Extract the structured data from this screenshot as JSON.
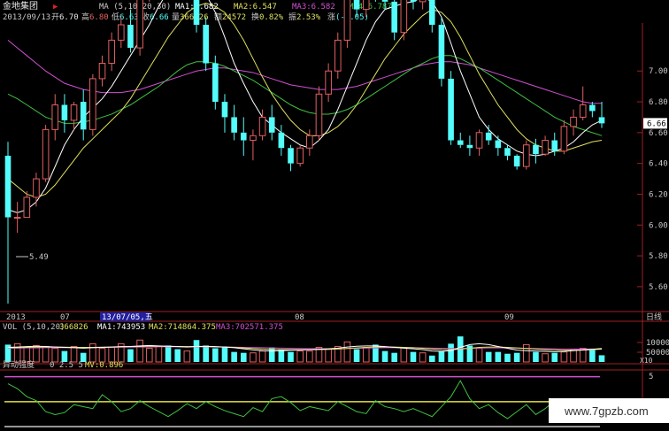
{
  "info": {
    "stock_name": "金地集团",
    "date_line": "2013/09/13",
    "open_label": "开",
    "open_value": "6.70",
    "high_label": "高",
    "high_value": "6.80",
    "low_label": "低",
    "low_value": "6.63",
    "close_label": "收",
    "close_value": "6.66",
    "vol_label": "量",
    "vol_value": "366826",
    "amount_label": "额",
    "amount_value": "24572",
    "turnover_label": "换",
    "turnover_value": "0.82%",
    "amplitude_label": "振",
    "amplitude_value": "2.53%",
    "change_label": "涨",
    "change_value": "(-0.05)",
    "ma_title": "MA (5,10,20,30)",
    "ma1": "MA1:6.682",
    "ma2": "MA2:6.547",
    "ma3": "MA3:6.582",
    "ma4": "MA4:6.787"
  },
  "toolbar": {
    "date_labels": [
      "2013",
      "07",
      "08",
      "09"
    ],
    "cursor_date": "13/07/05,五",
    "period_button": "日线"
  },
  "volume_panel": {
    "title": "VOL (5,10,20)",
    "value": "366826",
    "ma1": "MA1:743953",
    "ma2": "MA2:714864.375",
    "ma3": "MA3:702571.375",
    "y_ticks": [
      "100000",
      "50000"
    ],
    "unit": "X10"
  },
  "indicator_panel": {
    "title": "异动强度",
    "params": "0 2.5 5",
    "mv": "MV:0.896",
    "y_tick": "5"
  },
  "watermark": "www.7gpzb.com",
  "colors": {
    "up": "#e06060",
    "down": "#54fcfc",
    "ma1": "#ffffff",
    "ma2": "#e0e060",
    "ma3": "#d050d0",
    "ma4": "#40c040",
    "axis": "#a02020",
    "indicator_line": "#40c040",
    "level_high": "#d050d0",
    "level_mid": "#e0e040"
  },
  "chart_data": {
    "type": "candlestick",
    "y_ticks": [
      5.6,
      5.8,
      6.0,
      6.2,
      6.4,
      6.6,
      6.8,
      7.0
    ],
    "ylim": [
      5.45,
      7.3
    ],
    "min_label": "5.49",
    "last_price": "6.66",
    "candles": [
      [
        6.45,
        6.54,
        5.49,
        6.05
      ],
      [
        6.05,
        6.15,
        5.95,
        6.05
      ],
      [
        6.05,
        6.22,
        6.05,
        6.18
      ],
      [
        6.18,
        6.34,
        6.12,
        6.3
      ],
      [
        6.3,
        6.65,
        6.28,
        6.62
      ],
      [
        6.62,
        6.85,
        6.55,
        6.78
      ],
      [
        6.78,
        6.85,
        6.6,
        6.68
      ],
      [
        6.68,
        6.8,
        6.62,
        6.78
      ],
      [
        6.8,
        6.88,
        6.55,
        6.62
      ],
      [
        6.62,
        6.98,
        6.58,
        6.95
      ],
      [
        6.95,
        7.1,
        6.9,
        7.05
      ],
      [
        7.05,
        7.25,
        7.0,
        7.2
      ],
      [
        7.2,
        7.35,
        7.15,
        7.3
      ],
      [
        7.3,
        7.4,
        7.12,
        7.15
      ],
      [
        7.15,
        7.55,
        7.1,
        7.5
      ],
      [
        7.5,
        7.7,
        7.45,
        7.65
      ],
      [
        7.65,
        7.9,
        7.6,
        7.85
      ],
      [
        7.85,
        7.95,
        7.65,
        7.7
      ],
      [
        7.7,
        7.75,
        7.55,
        7.6
      ],
      [
        7.6,
        7.75,
        7.5,
        7.65
      ],
      [
        7.65,
        7.7,
        7.25,
        7.3
      ],
      [
        7.3,
        7.35,
        7.0,
        7.05
      ],
      [
        7.05,
        7.1,
        6.75,
        6.8
      ],
      [
        6.8,
        6.85,
        6.6,
        6.7
      ],
      [
        6.7,
        6.78,
        6.55,
        6.6
      ],
      [
        6.6,
        6.7,
        6.45,
        6.55
      ],
      [
        6.55,
        6.62,
        6.42,
        6.58
      ],
      [
        6.58,
        6.75,
        6.55,
        6.7
      ],
      [
        6.7,
        6.78,
        6.55,
        6.6
      ],
      [
        6.6,
        6.65,
        6.45,
        6.5
      ],
      [
        6.5,
        6.52,
        6.35,
        6.4
      ],
      [
        6.4,
        6.52,
        6.38,
        6.5
      ],
      [
        6.5,
        6.62,
        6.45,
        6.58
      ],
      [
        6.58,
        6.9,
        6.55,
        6.85
      ],
      [
        6.85,
        7.05,
        6.8,
        7.0
      ],
      [
        7.0,
        7.25,
        6.95,
        7.2
      ],
      [
        7.2,
        7.55,
        7.15,
        7.5
      ],
      [
        7.5,
        7.55,
        7.35,
        7.4
      ],
      [
        7.4,
        7.6,
        7.35,
        7.55
      ],
      [
        7.55,
        7.7,
        7.45,
        7.5
      ],
      [
        7.5,
        7.65,
        7.4,
        7.45
      ],
      [
        7.45,
        7.5,
        7.2,
        7.25
      ],
      [
        7.25,
        7.55,
        7.2,
        7.5
      ],
      [
        7.5,
        7.6,
        7.4,
        7.45
      ],
      [
        7.45,
        7.8,
        7.4,
        7.75
      ],
      [
        7.65,
        7.68,
        7.25,
        7.3
      ],
      [
        7.3,
        7.35,
        6.9,
        6.95
      ],
      [
        6.95,
        7.0,
        6.52,
        6.55
      ],
      [
        6.55,
        6.6,
        6.5,
        6.52
      ],
      [
        6.52,
        6.58,
        6.45,
        6.5
      ],
      [
        6.5,
        6.62,
        6.45,
        6.6
      ],
      [
        6.6,
        6.65,
        6.52,
        6.55
      ],
      [
        6.55,
        6.58,
        6.45,
        6.5
      ],
      [
        6.5,
        6.52,
        6.42,
        6.45
      ],
      [
        6.45,
        6.46,
        6.36,
        6.38
      ],
      [
        6.38,
        6.55,
        6.36,
        6.52
      ],
      [
        6.52,
        6.56,
        6.4,
        6.46
      ],
      [
        6.46,
        6.58,
        6.45,
        6.55
      ],
      [
        6.55,
        6.6,
        6.45,
        6.48
      ],
      [
        6.48,
        6.68,
        6.46,
        6.64
      ],
      [
        6.64,
        6.75,
        6.58,
        6.7
      ],
      [
        6.7,
        6.9,
        6.68,
        6.78
      ],
      [
        6.78,
        6.8,
        6.7,
        6.74
      ],
      [
        6.7,
        6.8,
        6.63,
        6.66
      ]
    ],
    "ma5": [
      6.1,
      6.08,
      6.1,
      6.15,
      6.24,
      6.38,
      6.52,
      6.62,
      6.7,
      6.76,
      6.82,
      6.9,
      7.0,
      7.1,
      7.2,
      7.3,
      7.42,
      7.52,
      7.58,
      7.62,
      7.6,
      7.5,
      7.38,
      7.22,
      7.05,
      6.92,
      6.8,
      6.7,
      6.65,
      6.6,
      6.56,
      6.52,
      6.5,
      6.55,
      6.62,
      6.75,
      6.9,
      7.05,
      7.2,
      7.32,
      7.4,
      7.42,
      7.44,
      7.45,
      7.48,
      7.45,
      7.35,
      7.18,
      7.0,
      6.85,
      6.7,
      6.62,
      6.56,
      6.52,
      6.48,
      6.46,
      6.45,
      6.46,
      6.48,
      6.5,
      6.54,
      6.6,
      6.65,
      6.68
    ],
    "ma10": [
      6.3,
      6.25,
      6.2,
      6.18,
      6.2,
      6.26,
      6.34,
      6.42,
      6.5,
      6.56,
      6.62,
      6.68,
      6.74,
      6.82,
      6.92,
      7.02,
      7.12,
      7.22,
      7.3,
      7.38,
      7.42,
      7.44,
      7.42,
      7.38,
      7.3,
      7.2,
      7.08,
      6.96,
      6.85,
      6.76,
      6.68,
      6.62,
      6.58,
      6.58,
      6.6,
      6.64,
      6.7,
      6.78,
      6.88,
      6.98,
      7.08,
      7.16,
      7.24,
      7.3,
      7.36,
      7.4,
      7.38,
      7.32,
      7.22,
      7.1,
      6.98,
      6.88,
      6.78,
      6.7,
      6.62,
      6.56,
      6.52,
      6.5,
      6.48,
      6.48,
      6.5,
      6.52,
      6.54,
      6.55
    ],
    "ma20": [
      6.85,
      6.82,
      6.78,
      6.74,
      6.7,
      6.68,
      6.66,
      6.66,
      6.67,
      6.68,
      6.7,
      6.72,
      6.75,
      6.78,
      6.82,
      6.86,
      6.9,
      6.95,
      7.0,
      7.04,
      7.06,
      7.06,
      7.05,
      7.03,
      7.0,
      6.97,
      6.94,
      6.9,
      6.86,
      6.82,
      6.78,
      6.75,
      6.73,
      6.72,
      6.72,
      6.73,
      6.75,
      6.78,
      6.82,
      6.86,
      6.9,
      6.94,
      6.98,
      7.02,
      7.05,
      7.08,
      7.1,
      7.1,
      7.08,
      7.05,
      7.02,
      6.98,
      6.94,
      6.9,
      6.86,
      6.82,
      6.78,
      6.74,
      6.7,
      6.67,
      6.64,
      6.62,
      6.6,
      6.58
    ],
    "ma30": [
      7.2,
      7.15,
      7.1,
      7.05,
      7.0,
      6.96,
      6.92,
      6.9,
      6.88,
      6.87,
      6.86,
      6.86,
      6.86,
      6.87,
      6.88,
      6.9,
      6.92,
      6.94,
      6.96,
      6.98,
      7.0,
      7.01,
      7.02,
      7.02,
      7.01,
      7.0,
      6.99,
      6.97,
      6.95,
      6.93,
      6.91,
      6.9,
      6.89,
      6.88,
      6.88,
      6.88,
      6.89,
      6.9,
      6.92,
      6.94,
      6.96,
      6.98,
      7.0,
      7.02,
      7.04,
      7.05,
      7.06,
      7.06,
      7.05,
      7.04,
      7.02,
      7.0,
      6.98,
      6.96,
      6.94,
      6.92,
      6.9,
      6.88,
      6.86,
      6.84,
      6.82,
      6.8,
      6.79,
      6.79
    ],
    "volume": {
      "ylim": [
        0,
        160000
      ],
      "values": [
        95000,
        100000,
        80000,
        90000,
        85000,
        75000,
        60000,
        85000,
        50000,
        100000,
        75000,
        80000,
        100000,
        70000,
        120000,
        75000,
        85000,
        90000,
        70000,
        60000,
        120000,
        90000,
        75000,
        85000,
        55000,
        50000,
        50000,
        60000,
        80000,
        70000,
        55000,
        60000,
        60000,
        80000,
        70000,
        85000,
        110000,
        70000,
        80000,
        95000,
        60000,
        50000,
        80000,
        55000,
        50000,
        35000,
        60000,
        100000,
        140000,
        90000,
        75000,
        55000,
        55000,
        45000,
        50000,
        95000,
        55000,
        45000,
        50000,
        55000,
        70000,
        75000,
        65000,
        36682
      ],
      "ma5": [
        80000,
        82000,
        84000,
        86000,
        85000,
        82000,
        80000,
        78000,
        76000,
        78000,
        80000,
        82000,
        84000,
        85000,
        88000,
        90000,
        88000,
        86000,
        84000,
        82000,
        85000,
        86000,
        84000,
        82000,
        78000,
        72000,
        66000,
        62000,
        60000,
        62000,
        64000,
        66000,
        68000,
        70000,
        72000,
        76000,
        82000,
        86000,
        88000,
        88000,
        84000,
        80000,
        76000,
        72000,
        68000,
        60000,
        58000,
        62000,
        80000,
        95000,
        100000,
        95000,
        85000,
        75000,
        65000,
        62000,
        60000,
        58000,
        56000,
        58000,
        62000,
        66000,
        70000,
        74000
      ],
      "ma10": [
        78000,
        79000,
        80000,
        81000,
        82000,
        82000,
        81000,
        80000,
        80000,
        80000,
        81000,
        82000,
        83000,
        84000,
        85000,
        86000,
        86000,
        86000,
        85000,
        84000,
        84000,
        84000,
        83000,
        82000,
        80000,
        77000,
        74000,
        71000,
        69000,
        68000,
        67000,
        67000,
        67000,
        68000,
        69000,
        71000,
        74000,
        77000,
        80000,
        82000,
        83000,
        82000,
        80000,
        78000,
        75000,
        71000,
        68000,
        67000,
        70000,
        75000,
        80000,
        82000,
        82000,
        80000,
        77000,
        74000,
        71000,
        68000,
        66000,
        64000,
        64000,
        65000,
        67000,
        70000
      ],
      "ma20": [
        76000,
        76000,
        77000,
        77000,
        78000,
        78000,
        78000,
        79000,
        79000,
        79000,
        80000,
        80000,
        81000,
        81000,
        82000,
        82000,
        83000,
        83000,
        83000,
        83000,
        83000,
        83000,
        82000,
        82000,
        81000,
        80000,
        79000,
        78000,
        77000,
        76000,
        75000,
        74000,
        73000,
        73000,
        73000,
        73000,
        74000,
        75000,
        76000,
        77000,
        78000,
        78000,
        78000,
        78000,
        77000,
        76000,
        75000,
        74000,
        74000,
        75000,
        76000,
        77000,
        77000,
        77000,
        76000,
        75000,
        74000,
        73000,
        72000,
        71000,
        71000,
        71000,
        71000,
        70000
      ]
    },
    "indicator": {
      "ylim": [
        0,
        5.5
      ],
      "levels": [
        5,
        2.5,
        0
      ],
      "values": [
        4.3,
        3.8,
        3.0,
        2.6,
        1.5,
        1.2,
        1.4,
        2.2,
        2.0,
        1.8,
        3.2,
        2.5,
        1.5,
        1.8,
        2.6,
        2.0,
        1.5,
        1.0,
        1.6,
        2.3,
        1.8,
        2.5,
        2.0,
        1.6,
        1.3,
        1.0,
        1.9,
        1.5,
        2.8,
        3.0,
        2.4,
        1.6,
        2.0,
        1.8,
        1.6,
        2.5,
        2.0,
        1.5,
        1.3,
        2.6,
        2.0,
        1.8,
        1.5,
        1.8,
        1.4,
        1.0,
        2.0,
        3.0,
        4.6,
        2.8,
        1.8,
        2.2,
        1.4,
        0.8,
        1.5,
        2.2,
        1.2,
        1.8,
        2.6,
        1.4,
        0.8,
        1.2,
        1.0,
        0.9
      ]
    }
  }
}
